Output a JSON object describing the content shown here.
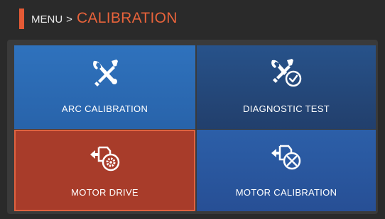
{
  "header": {
    "parent": "MENU",
    "separator": ">",
    "title": "CALIBRATION"
  },
  "tiles": [
    {
      "label": "ARC CALIBRATION",
      "icon": "tools-icon"
    },
    {
      "label": "DIAGNOSTIC TEST",
      "icon": "tools-check-icon"
    },
    {
      "label": "MOTOR DRIVE",
      "icon": "motor-gear-icon",
      "selected": true
    },
    {
      "label": "MOTOR CALIBRATION",
      "icon": "motor-wrench-icon"
    }
  ],
  "colors": {
    "accent": "#e45a35",
    "tile_blue": "#2f72bd",
    "tile_selected": "#a83c2a"
  }
}
